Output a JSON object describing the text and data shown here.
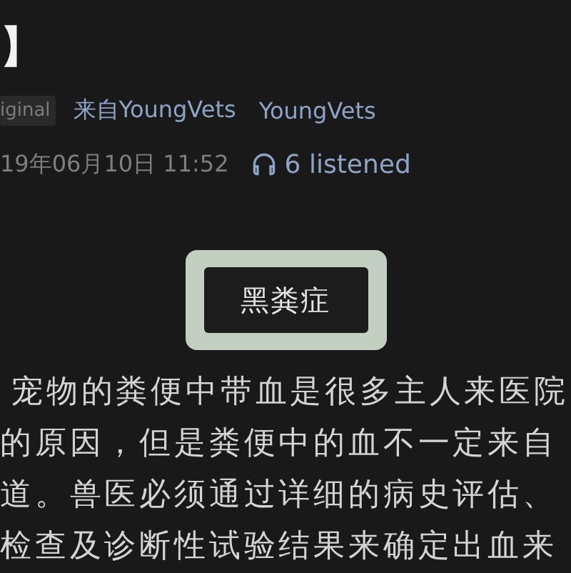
{
  "title": "】",
  "meta": {
    "tag": "iginal",
    "source": "来自YoungVets",
    "author": "YoungVets"
  },
  "info": {
    "date": "19年06月10日 11:52",
    "listened": "6 listened"
  },
  "section_heading": "黑粪症",
  "paragraph_lines": [
    "宠物的粪便中带血是很多主人来医院",
    "的原因，但是粪便中的血不一定来自",
    "道。兽医必须通过详细的病史评估、",
    "检查及诊断性试验结果来确定出血来"
  ]
}
